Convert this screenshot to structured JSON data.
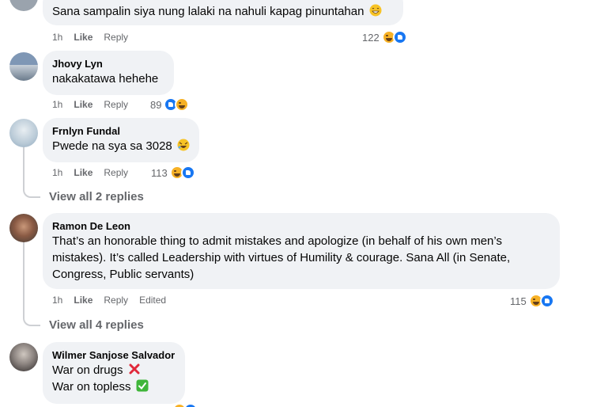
{
  "comments": [
    {
      "author": "",
      "text": "Sana sampalin siya nung lalaki na nahuli kapag pinuntahan",
      "text_emoji": "grin-icon",
      "time": "1h",
      "like": "Like",
      "reply": "Reply",
      "reaction_count": "122"
    },
    {
      "author": "Jhovy Lyn",
      "text": "nakakatawa hehehe",
      "time": "1h",
      "like": "Like",
      "reply": "Reply",
      "reaction_count": "89"
    },
    {
      "author": "Frnlyn Fundal",
      "text": "Pwede na sya sa 3028",
      "text_emoji": "rofl-icon",
      "time": "1h",
      "like": "Like",
      "reply": "Reply",
      "reaction_count": "113",
      "view_replies": "View all 2 replies"
    },
    {
      "author": "Ramon De Leon",
      "text_lines": [
        "That’s an honorable thing to admit mistakes and apologize (in behalf of his own men’s",
        "mistakes). It’s called Leadership with virtues of Humility & courage. Sana All (in Senate,",
        "Congress, Public servants)"
      ],
      "time": "1h",
      "like": "Like",
      "reply": "Reply",
      "edited": "Edited",
      "reaction_count": "115",
      "view_replies": "View all 4 replies"
    },
    {
      "author": "Wilmer Sanjose Salvador",
      "text_lines": [
        "War on drugs",
        "War on topless"
      ],
      "line_emojis": [
        "cross-mark-icon",
        "check-mark-icon"
      ]
    }
  ],
  "colors": {
    "bubble": "#f0f2f5",
    "meta": "#65676b",
    "like_blue": "#1877f2",
    "haha_yellow": "#f7b125",
    "thread": "#ced0d4"
  }
}
